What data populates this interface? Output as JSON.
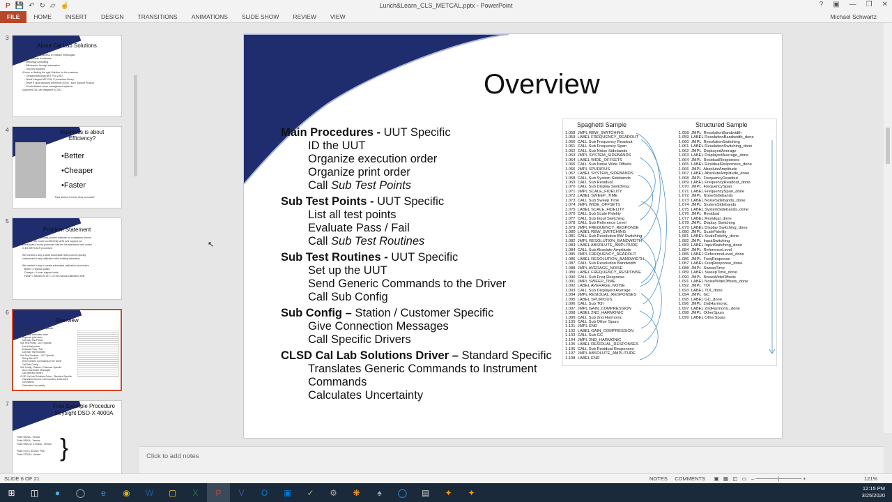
{
  "window": {
    "title": "Lunch&Learn_CLS_METCAL.pptx - PowerPoint",
    "user": "Michael Schwartz"
  },
  "ribbon": {
    "tabs": [
      "HOME",
      "INSERT",
      "DESIGN",
      "TRANSITIONS",
      "ANIMATIONS",
      "SLIDE SHOW",
      "REVIEW",
      "VIEW"
    ],
    "file": "FILE"
  },
  "thumbnails": [
    {
      "num": "3",
      "title": "About Cal Lab Solutions",
      "text": "•Veteran owned business, ex military metrologist\n•Core Business is software\n   ◦ Metrology consulting\n   ◦ Efficiencies through automation\n   ◦ Turn-key systems\n•Focus on finding the right Solution for the customer\n   ◦ Created Metrology.NET ® in 2010\n   ◦ World's largest METCAL ® procedure library\n   ◦ Devel ® gold standard reference (2016) - Now Support Product\n   ◦ Of refurbished reuse management systems\n•Acquired Cal Lab Magazine in 2011"
    },
    {
      "num": "4",
      "title": "Business is about Efficiency?",
      "bullets": [
        "•Better",
        "•Cheaper",
        "•Faster"
      ],
      "note": "That doesn't mean less accurate"
    },
    {
      "num": "5",
      "title": "Problem Statement",
      "text": "Cal Lab Solutions writes custom software for companies around\nthe world. We could not efficiently write and support our\nprocedures if every procedure had the lab standards hard coded\nin the METCAL® procedure.\n\nWe needed a way to write automation that could be quickly\ncustomized to any calibration lab's existing standards.\n\nWe needed a way to create automated calibration procedures\n   Better = Highest quality\n   Cheaper = Lower support costs\n   Faster = Needed to be < 1/2 the manual calibration time"
    },
    {
      "num": "6",
      "title": "Overview",
      "text": "Main Procedures - UUT Specific\n   ID the UUT\n   Organize execution order\n   Organize print order\n   Call Sub Test Points\nSub Test Points - UUT Specific\n   List all test points\n   Evaluate Pass / Fail\n   Call Sub Test Routines\nSub Test Routines - UUT Specific\n   Set up the UUT\n   Send Generic Commands to the Driver\n   Call Sub Config\nSub Config - Station / Customer Specific\n   Give Connection Messages\n   Call Specific Drivers\nCLSD Cal Lab Solutions Driver - Standard Specific\n   Translates Generic Commands to Instrument\n   Commands\n   Calculates Uncertainty"
    },
    {
      "num": "7",
      "title": "Free Example Procedure\nKeysight DSO-X 4000A",
      "text": "Fluke 5520A - Vendor\nFluke 5500A - Vendor\nFluke 5500 w/ 5 Heads - Vendor\n\nFluke 5720 / 5010A / P55 /\nFluke 5730A + Vendor"
    }
  ],
  "slide": {
    "title": "Overview",
    "sections": [
      {
        "head": "Main Procedures - ",
        "tail": "UUT Specific",
        "items": [
          "ID the UUT",
          "Organize execution order",
          "Organize print order"
        ],
        "italic_item": [
          "Call ",
          "Sub Test Points"
        ]
      },
      {
        "head": "Sub Test Points - ",
        "tail": "UUT Specific",
        "items": [
          "List all test points",
          "Evaluate Pass / Fail"
        ],
        "italic_item": [
          "Call ",
          "Sub Test Routines"
        ]
      },
      {
        "head": "Sub Test Routines - ",
        "tail": "UUT Specific",
        "items": [
          "Set up the UUT",
          "Send Generic Commands to the Driver",
          "Call Sub Config"
        ]
      },
      {
        "head": "Sub Config – ",
        "tail": "Station / Customer Specific",
        "items": [
          "Give Connection Messages",
          "Call Specific Drivers"
        ]
      },
      {
        "head": "CLSD Cal Lab Solutions Driver – ",
        "tail": "Standard Specific",
        "items": [
          "Translates Generic Commands to Instrument",
          "Commands",
          "Calculates Uncertainty"
        ]
      }
    ],
    "spaghetti_title": "Spaghetti Sample",
    "structured_title": "Structured Sample",
    "spaghetti_lines": "1.058  JMPL RBW_SWITCHING\n1.059  LABEL FREQUENCY_READOUT\n1.060  CALL Sub Frequency Readout\n1.061  CALL Sub Frequency Span\n1.062  CALL Sub Noise Sidebands\n1.063  JMPL SYSTEM_SIDEBANDS\n1.064  LABEL WIDE_OFFSETS\n1.065  CALL Sub Noise Wide Offsets\n1.066  JMPL SPURIOUS\n1.067  LABEL SYSTEM_SIDEBANDS\n1.068  CALL Sub System Sidebands\n1.069  CALL Sub Residual\n1.070  CALL Sub Display Switching\n1.071  JMPL SCALE_FIDELITY\n1.072  LABEL SWEEP_TIME\n1.073  CALL Sub Sweep Time\n1.074  JMPL WIDE_OFFSETS\n1.075  LABEL SCALE_FIDELITY\n1.076  CALL Sub Scale Fidelity\n1.077  CALL Sub Input Switching\n1.078  CALL Sub Reference Level\n1.079  JMPL FREQUENCY_RESPONSE\n1.080  LABEL RBW_SWITCHING\n1.081  CALL Sub Resolution BW Switching\n1.082  JMPL RESOLUTION_BANDWIDTH\n1.083  LABEL ABSOLUTE_AMPLITUDE\n1.084  CALL Sub Absolute Amplitude\n1.085  JMPL FREQUENCY_READOUT\n1.086  LABEL RESOLUTION_BANDWIDTH\n1.087  CALL Sub Resolution Bandwidth\n1.088  JMPL AVERAGE_NOISE\n1.089  LABEL FREQUENCY_RESPONSE\n1.090  CALL Sub Freq Response\n1.091  JMPL SWEEP_TIME\n1.092  LABEL AVERAGE_NOISE\n1.093  CALL Sub Displayed Average\n1.094  JMPL RESIDUAL_RESPONSES\n1.095  LABEL SPURIOUS\n1.096  CALL Sub TOI\n1.097  JMPL GAIN_COMPRESSION\n1.098  LABEL 2ND_HARMONIC\n1.099  CALL Sub 2nd Harmonic\n1.100  CALL Sub Other Spurs\n1.101  JMPL END\n1.102  LABEL GAIN_COMPRESSION\n1.103  CALL Sub GC\n1.104  JMPL 2ND_HARMONIC\n1.105  LABEL RESIDUAL_RESPONSES\n1.106  CALL Sub Residual Responses\n1.107  JMPL ABSOLUTE_AMPLITUDE\n1.108  LABEL END",
    "structured_lines": "1.058  JMPL  ResolutionBandwidth\n1.059  LABEL ResolutionBandwidth_done\n1.060  JMPL  ResolutionSwitching\n1.061  LABEL ResolutionSwitching_done\n1.062  JMPL  DisplayedAverage\n1.063  LABEL DisplayedAverage_done\n1.064  JMPL  ResidualResponses\n1.065  LABEL ResidualResponses_done\n1.066  JMPL  AbsoluteAmplitude\n1.067  LABEL AbsoluteAmplitude_done\n1.068  JMPL  FrequencyReadout\n1.069  LABEL FrequencyReadout_done\n1.070  JMPL  FrequencySpan\n1.071  LABEL FrequencySpan_done\n1.072  JMPL  NoiseSidebands\n1.073  LABEL NoiseSidebands_done\n1.074  JMPL  SystemSidebands\n1.075  LABEL SystemSidebands_done\n1.076  JMPL  Residual\n1.077  LABEL Residual_done\n1.078  JMPL  Display Switching\n1.079  LABEL Display Switching_done\n1.080  JMPL  ScaleFidelity\n1.081  LABEL ScaleFidelity_done\n1.082  JMPL  InputSwitching\n1.083  LABEL InputSwitching_done\n1.084  JMPL  ReferenceLevel\n1.085  LABEL ReferenceLevel_done\n1.086  JMPL  FreqResponse\n1.087  LABEL FreqResponse_done\n1.088  JMPL  SweepTime\n1.089  LABEL SweepTime_done\n1.090  JMPL  NoiseWideOffsets\n1.091  LABEL NoiseWideOffsets_done\n1.092  JMPL  TOI\n1.093  LABEL TOI_done\n1.094  JMPL  GC\n1.095  LABEL GC_done\n1.096  JMPL  2ndHarmonic\n1.097  LABEL 2ndHarmonic_done\n1.098  JMPL  OtherSpurs\n1.099  LABEL OtherSpurs"
  },
  "notes": {
    "placeholder": "Click to add notes"
  },
  "status": {
    "slide": "SLIDE 6 OF 21",
    "notes": "NOTES",
    "comments": "COMMENTS",
    "zoom": "121%"
  },
  "taskbar": {
    "time": "12:15 PM",
    "date": "3/25/2020"
  },
  "colors": {
    "accent": "#d24726",
    "file_tab": "#b7472a",
    "slide_blue": "#1f2d6e"
  }
}
